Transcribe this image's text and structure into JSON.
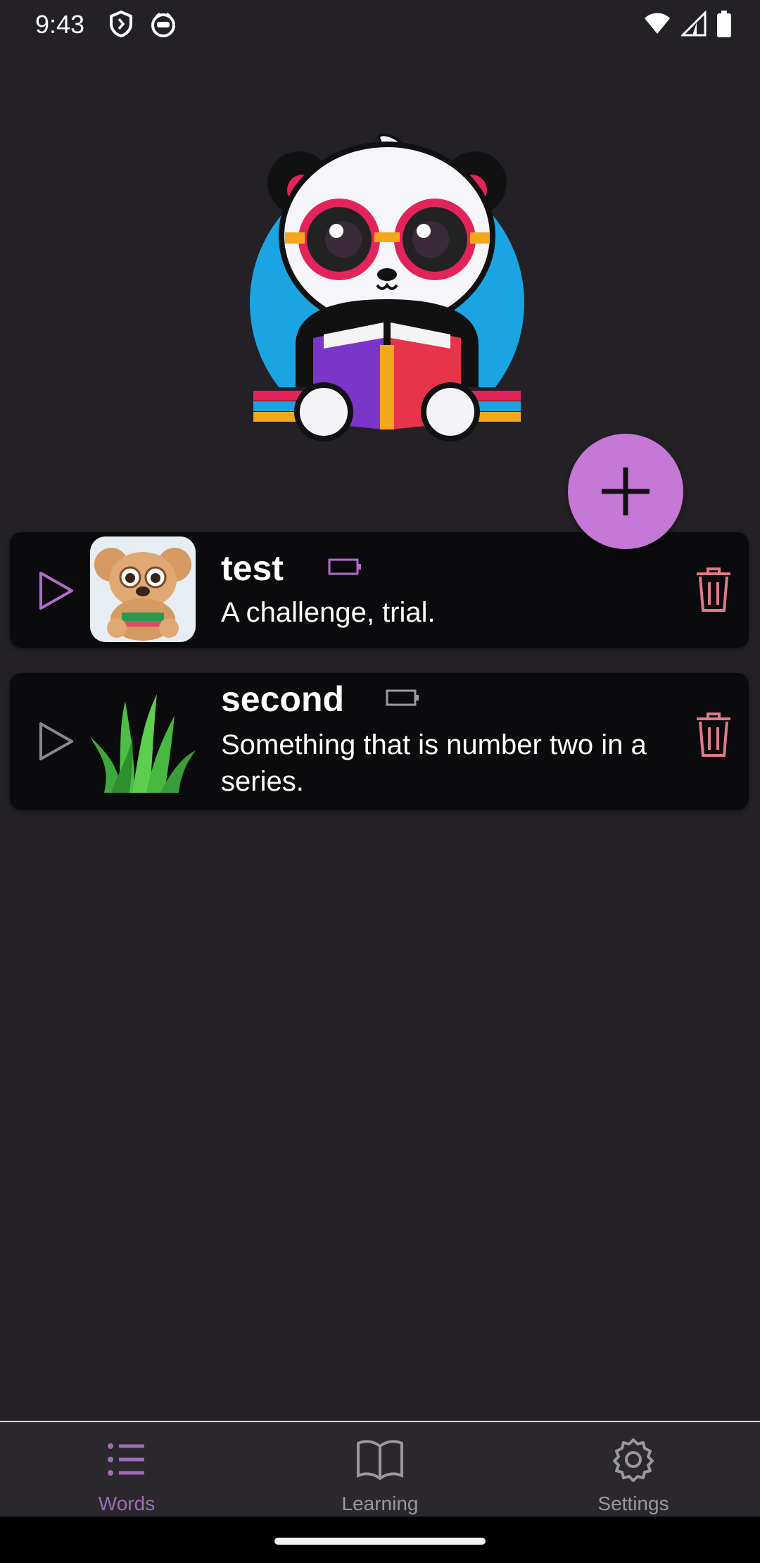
{
  "status_bar": {
    "time": "9:43",
    "icons": [
      "shield-icon",
      "app-face-icon",
      "wifi-icon",
      "signal-icon",
      "battery-icon"
    ]
  },
  "logo": {
    "icon": "panda-reading-logo"
  },
  "fab": {
    "icon": "plus-icon",
    "color": "#c578d6"
  },
  "words": [
    {
      "title": "test",
      "definition": "A challenge, trial.",
      "image": "koala-thumbnail",
      "play_icon": "play-icon",
      "badge_icon": "battery-outline-icon",
      "delete_icon": "trash-icon"
    },
    {
      "title": "second",
      "definition": "Something that is number two in a series.",
      "image": "grass-thumbnail",
      "play_icon": "play-icon",
      "badge_icon": "battery-outline-icon",
      "delete_icon": "trash-icon"
    }
  ],
  "bottom_nav": {
    "items": [
      {
        "label": "Words",
        "icon": "list-icon",
        "active": true
      },
      {
        "label": "Learning",
        "icon": "book-icon",
        "active": false
      },
      {
        "label": "Settings",
        "icon": "gear-icon",
        "active": false
      }
    ]
  },
  "colors": {
    "accent": "#c578d6",
    "active_nav": "#a06cb8",
    "delete": "#e07a8a",
    "background": "#232125",
    "card": "#0b0a0c"
  }
}
